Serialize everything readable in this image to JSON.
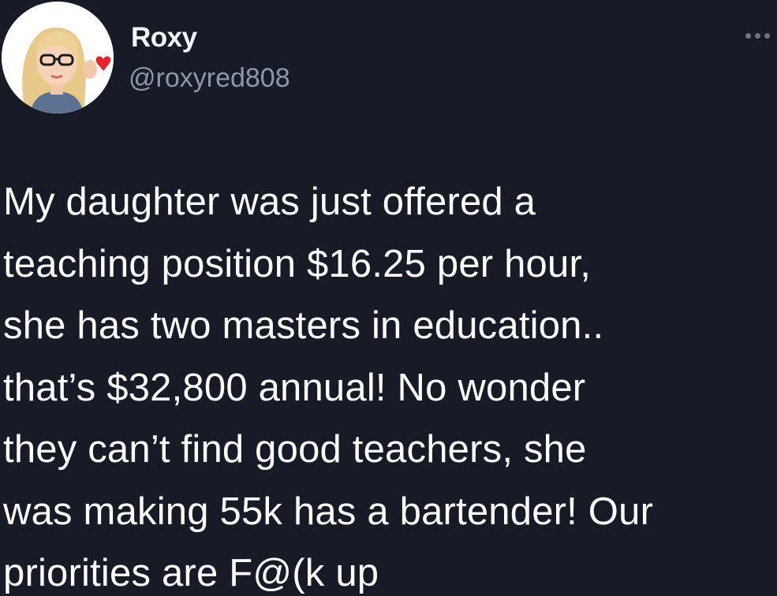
{
  "author": {
    "display_name": "Roxy",
    "handle": "@roxyred808",
    "avatar": "memoji-avatar-blonde-glasses-heart"
  },
  "menu": {
    "icon": "more-options-icon"
  },
  "tweet": {
    "lines": [
      "My daughter was just offered a",
      "teaching position $16.25 per hour,",
      "she has two masters in education..",
      "that’s $32,800 annual! No wonder",
      "they can’t find good teachers, she",
      "was making 55k has a bartender! Our",
      "priorities are F@(k up"
    ]
  },
  "colors": {
    "background": "#161b26",
    "text": "#ffffff",
    "handle": "#8b98a5",
    "accent_heart": "#e8232e"
  }
}
